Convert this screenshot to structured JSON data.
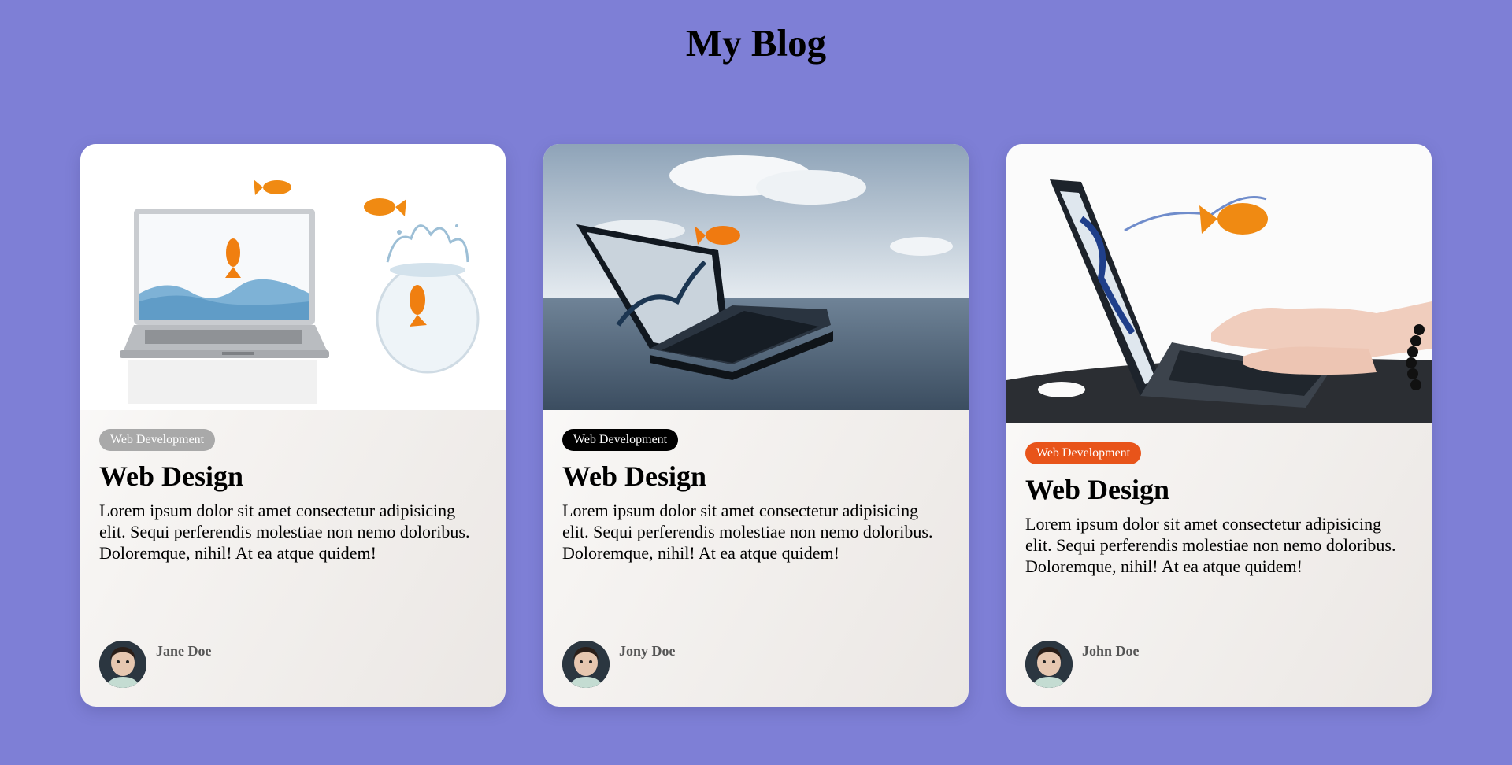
{
  "page": {
    "title": "My Blog"
  },
  "posts": [
    {
      "tag": "Web Development",
      "tag_color": "#a9a9a9",
      "title": "Web Design",
      "excerpt": "Lorem ipsum dolor sit amet consectetur adipisicing elit. Sequi perferendis molestiae non nemo doloribus. Doloremque, nihil! At ea atque quidem!",
      "author": "Jane Doe",
      "image": "silver-laptop-goldfish-bowl-image"
    },
    {
      "tag": "Web Development",
      "tag_color": "#000000",
      "title": "Web Design",
      "excerpt": "Lorem ipsum dolor sit amet consectetur adipisicing elit. Sequi perferendis molestiae non nemo doloribus. Doloremque, nihil! At ea atque quidem!",
      "author": "Jony Doe",
      "image": "laptop-in-ocean-goldfish-image"
    },
    {
      "tag": "Web Development",
      "tag_color": "#e8541a",
      "title": "Web Design",
      "excerpt": "Lorem ipsum dolor sit amet consectetur adipisicing elit. Sequi perferendis molestiae non nemo doloribus. Doloremque, nihil! At ea atque quidem!",
      "author": "John Doe",
      "image": "typing-laptop-goldfish-splash-image"
    }
  ],
  "colors": {
    "background": "#7e7fd6",
    "card_gradient_end": "#ebe7e4"
  }
}
